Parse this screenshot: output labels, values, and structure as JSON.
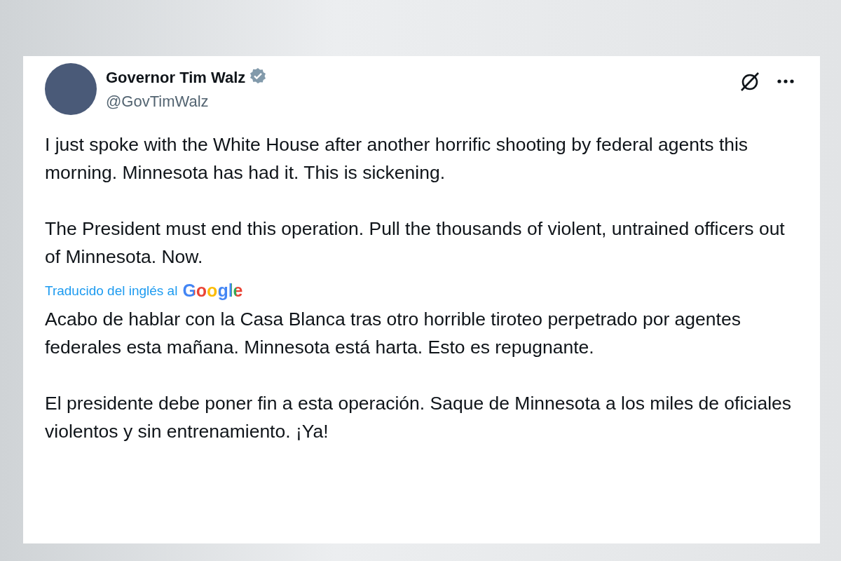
{
  "post": {
    "author": {
      "name": "Governor Tim Walz",
      "handle": "@GovTimWalz",
      "verified": true
    },
    "paragraphs": [
      "I just spoke with the White House after another horrific shooting by federal agents this morning. Minnesota has had it. This is sickening.",
      "The President must end this operation. Pull the thousands of violent, untrained officers out of Minnesota. Now."
    ],
    "translation": {
      "note": "Traducido del inglés al",
      "provider": "Google"
    },
    "translated_paragraphs": [
      "Acabo de hablar con la Casa Blanca tras otro horrible tiroteo perpetrado por agentes federales esta mañana. Minnesota está harta. Esto es repugnante.",
      "El presidente debe poner fin a esta operación. Saque de Minnesota a los miles de oficiales violentos y sin entrenamiento. ¡Ya!"
    ]
  }
}
